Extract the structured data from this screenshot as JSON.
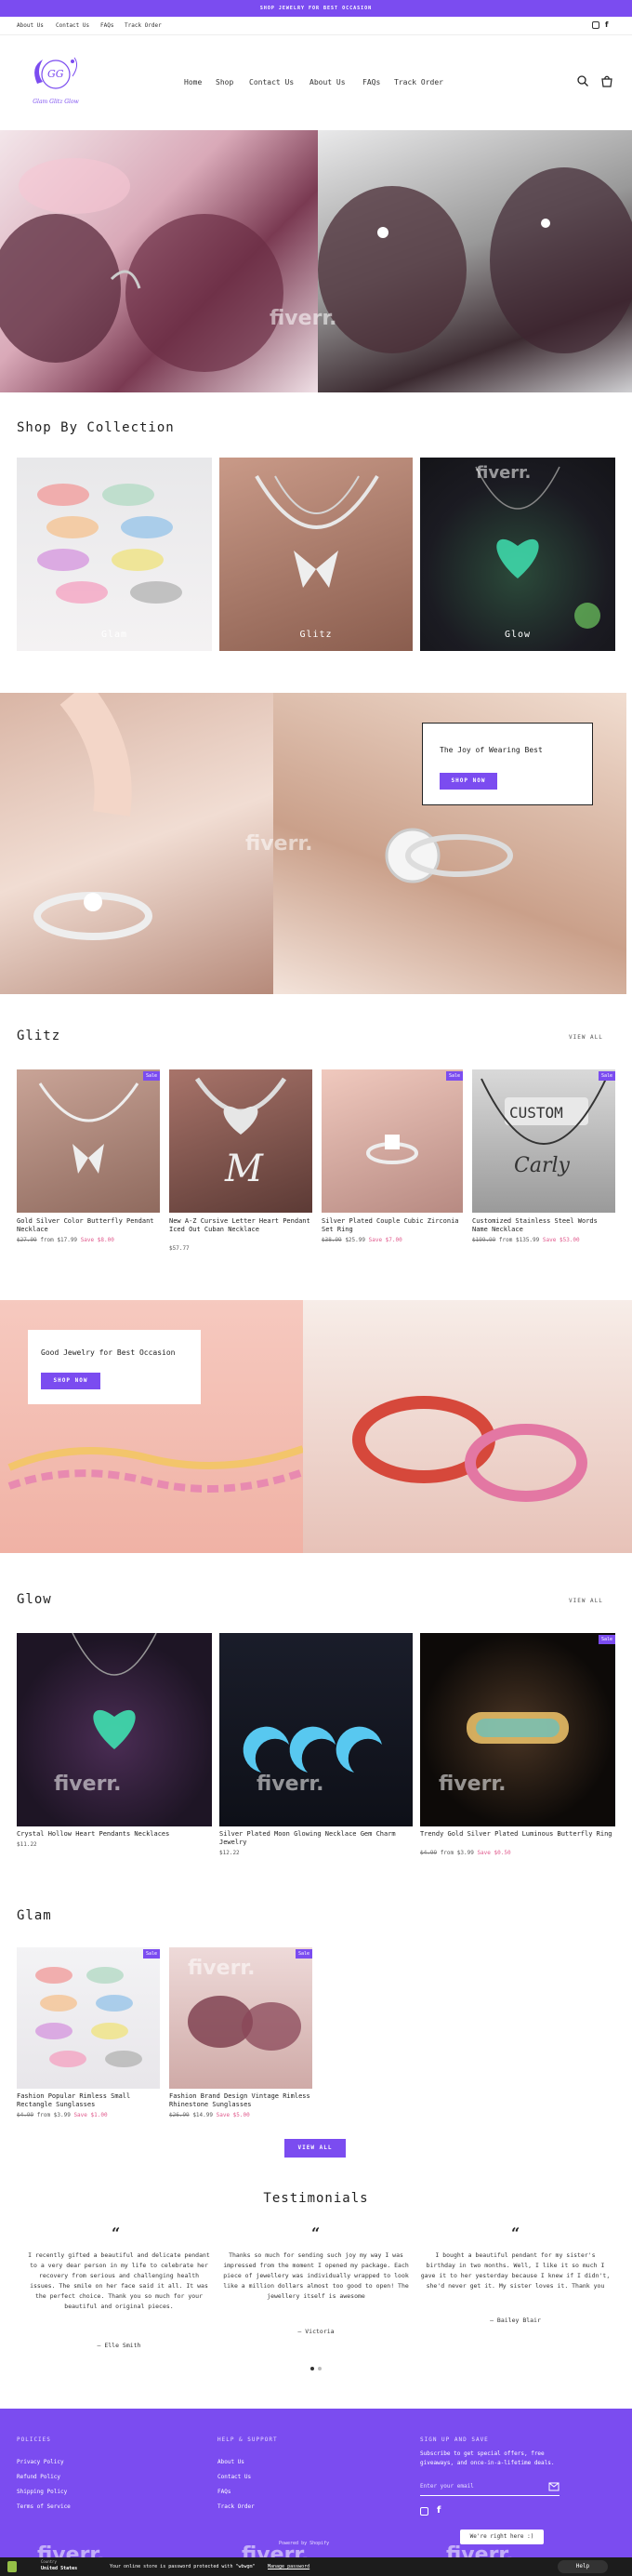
{
  "announcement": "SHOP JEWELRY FOR BEST OCCASION",
  "topnav": {
    "about": "About Us",
    "contact": "Contact Us",
    "faqs": "FAQs",
    "track": "Track Order"
  },
  "logo": {
    "monogram": "GG",
    "text": "Glam Glitz Glow"
  },
  "mainnav": {
    "home": "Home",
    "shop": "Shop",
    "contact": "Contact Us",
    "about": "About Us",
    "faqs": "FAQs",
    "track": "Track Order"
  },
  "watermark": "fiverr.",
  "collections": {
    "title": "Shop By Collection",
    "items": [
      {
        "label": "Glam"
      },
      {
        "label": "Glitz"
      },
      {
        "label": "Glow"
      }
    ]
  },
  "promo1": {
    "title": "The Joy of Wearing Best",
    "button": "SHOP NOW"
  },
  "glitz": {
    "title": "Glitz",
    "view_all": "VIEW ALL",
    "products": [
      {
        "title": "Gold Silver Color Butterfly Pendant Necklace",
        "old": "$27.99",
        "from": "from $17.99",
        "save": "Save $8.00",
        "badge": "Sale"
      },
      {
        "title": "New A-Z Cursive Letter Heart Pendant Iced Out Cuban Necklace",
        "price": "$57.77"
      },
      {
        "title": "Silver Plated Couple Cubic Zirconia Set Ring",
        "old": "$38.99",
        "from": "$25.99",
        "save": "Save $7.00",
        "badge": "Sale"
      },
      {
        "title": "Customized Stainless Steel Words Name Necklace",
        "old": "$199.99",
        "from": "from $135.99",
        "save": "Save $53.00",
        "badge": "Sale"
      }
    ]
  },
  "promo2": {
    "title": "Good Jewelry for Best Occasion",
    "button": "SHOP NOW"
  },
  "glow": {
    "title": "Glow",
    "view_all": "VIEW ALL",
    "products": [
      {
        "title": "Crystal Hollow Heart Pendants Necklaces",
        "price": "$11.22"
      },
      {
        "title": "Silver Plated Moon Glowing Necklace Gem Charm Jewelry",
        "price": "$12.22"
      },
      {
        "title": "Trendy Gold Silver Plated Luminous Butterfly Ring",
        "old": "$4.99",
        "from": "from $3.99",
        "save": "Save $0.50",
        "badge": "Sale"
      }
    ]
  },
  "glam": {
    "title": "Glam",
    "button": "VIEW ALL",
    "products": [
      {
        "title": "Fashion Popular Rimless Small Rectangle Sunglasses",
        "old": "$4.99",
        "from": "from $3.99",
        "save": "Save $1.00",
        "badge": "Sale"
      },
      {
        "title": "Fashion Brand Design Vintage Rimless Rhinestone Sunglasses",
        "old": "$26.99",
        "from": "$14.99",
        "save": "Save $5.00",
        "badge": "Sale"
      }
    ]
  },
  "testimonials": {
    "title": "Testimonials",
    "items": [
      {
        "text": "I recently gifted a beautiful and delicate pendant to a very dear person in my life to celebrate her recovery from serious and challenging health issues.   The smile on her face said it all.   It was the perfect choice. Thank you so much for your beautiful and original pieces.",
        "author": "— Elle Smith"
      },
      {
        "text": "Thanks so much for sending such joy my way I was impressed from the moment I opened my package. Each piece of jewellery was individually wrapped to look like a million dollars   almost too good to open! The jewellery itself is awesome",
        "author": "— Victoria"
      },
      {
        "text": "I bought a beautiful pendant for my sister's birthday in two months. Well, I like it so much I gave it to her yesterday because I knew if I didn't, she'd never get it. My sister loves it. Thank you",
        "author": "— Bailey Blair"
      }
    ]
  },
  "footer": {
    "policies_title": "POLICIES",
    "policies": [
      "Privacy Policy",
      "Refund Policy",
      "Shipping Policy",
      "Terms of Service"
    ],
    "help_title": "HELP & SUPPORT",
    "help": [
      "About Us",
      "Contact Us",
      "FAQs",
      "Track Order"
    ],
    "signup_title": "SIGN UP AND SAVE",
    "signup_text": "Subscribe to get special offers, free giveaways, and once-in-a-lifetime deals.",
    "email_placeholder": "Enter your email",
    "country": "United States",
    "country_label": "Country",
    "powered": "Powered by Shopify",
    "password_notice": "Your online store is password protected with \"wbwgm\"",
    "manage": "Manage password",
    "help_btn": "Help",
    "fiverr_badge": "We're right here :)"
  },
  "colors": {
    "accent": "#7b4cf0",
    "sale": "#e05a8d"
  }
}
